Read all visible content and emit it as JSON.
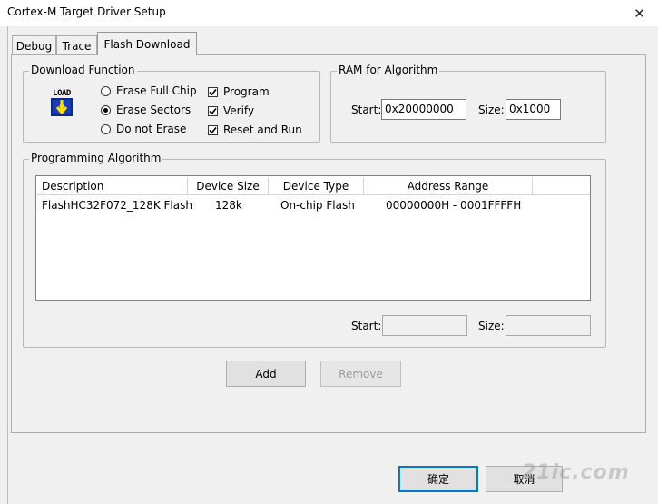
{
  "window": {
    "title": "Cortex-M Target Driver Setup",
    "close_glyph": "✕"
  },
  "tabs": [
    {
      "label": "Debug"
    },
    {
      "label": "Trace"
    },
    {
      "label": "Flash Download",
      "selected": true
    }
  ],
  "download_function": {
    "legend": "Download Function",
    "icon_text": "LOAD",
    "radios": [
      {
        "label": "Erase Full Chip",
        "selected": false
      },
      {
        "label": "Erase Sectors",
        "selected": true
      },
      {
        "label": "Do not Erase",
        "selected": false
      }
    ],
    "checks": [
      {
        "label": "Program",
        "checked": true
      },
      {
        "label": "Verify",
        "checked": true
      },
      {
        "label": "Reset and Run",
        "checked": true
      }
    ]
  },
  "ram": {
    "legend": "RAM for Algorithm",
    "start_label": "Start:",
    "start_value": "0x20000000",
    "size_label": "Size:",
    "size_value": "0x1000"
  },
  "programming": {
    "legend": "Programming Algorithm",
    "columns": [
      "Description",
      "Device Size",
      "Device Type",
      "Address Range"
    ],
    "rows": [
      {
        "description": "FlashHC32F072_128K Flash",
        "size": "128k",
        "type": "On-chip Flash",
        "range": "00000000H - 0001FFFFH"
      }
    ],
    "start_label": "Start:",
    "start_value": "",
    "size_label": "Size:",
    "size_value": ""
  },
  "buttons": {
    "add": "Add",
    "remove": "Remove",
    "ok": "确定",
    "cancel": "取消"
  },
  "watermark": "21ic.com",
  "colors": {
    "dialog_bg": "#f0f0f0",
    "ok_border": "#0078d7"
  }
}
